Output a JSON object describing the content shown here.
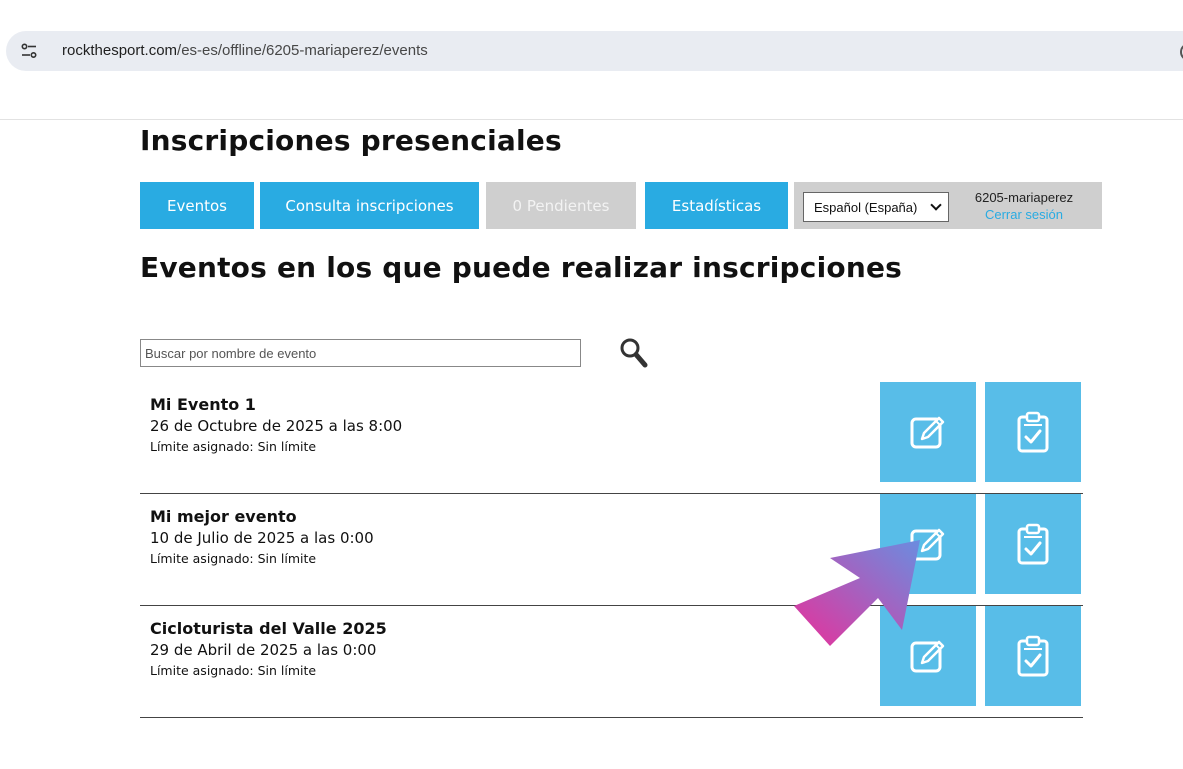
{
  "browser": {
    "url_domain": "rockthesport.com",
    "url_path": "/es-es/offline/6205-mariaperez/events"
  },
  "header": {
    "title": "Inscripciones presenciales"
  },
  "nav": {
    "events": "Eventos",
    "registrations": "Consulta inscripciones",
    "pending": "0 Pendientes",
    "stats": "Estadísticas",
    "language": "Español (España)",
    "username": "6205-mariaperez",
    "logout": "Cerrar sesión"
  },
  "section": {
    "title": "Eventos en los que puede realizar inscripciones"
  },
  "search": {
    "placeholder": "Buscar por nombre de evento"
  },
  "events": [
    {
      "name": "Mi Evento 1",
      "date": "26 de Octubre de 2025 a las 8:00",
      "limit": "Límite asignado: Sin límite"
    },
    {
      "name": "Mi mejor evento",
      "date": "10 de Julio de 2025 a las 0:00",
      "limit": "Límite asignado: Sin límite"
    },
    {
      "name": "Cicloturista del Valle 2025",
      "date": "29 de Abril de 2025 a las 0:00",
      "limit": "Límite asignado: Sin límite"
    }
  ],
  "icons": {
    "edit": "edit-icon",
    "clipboard": "clipboard-check-icon",
    "search": "search-icon",
    "site": "site-settings-icon",
    "pointer": "pointer-arrow-icon"
  },
  "colors": {
    "primary": "#29abe2",
    "action": "#58bde8",
    "disabled": "#cfcfcf",
    "arrow_start": "#e8309a",
    "arrow_end": "#6a8de0"
  }
}
